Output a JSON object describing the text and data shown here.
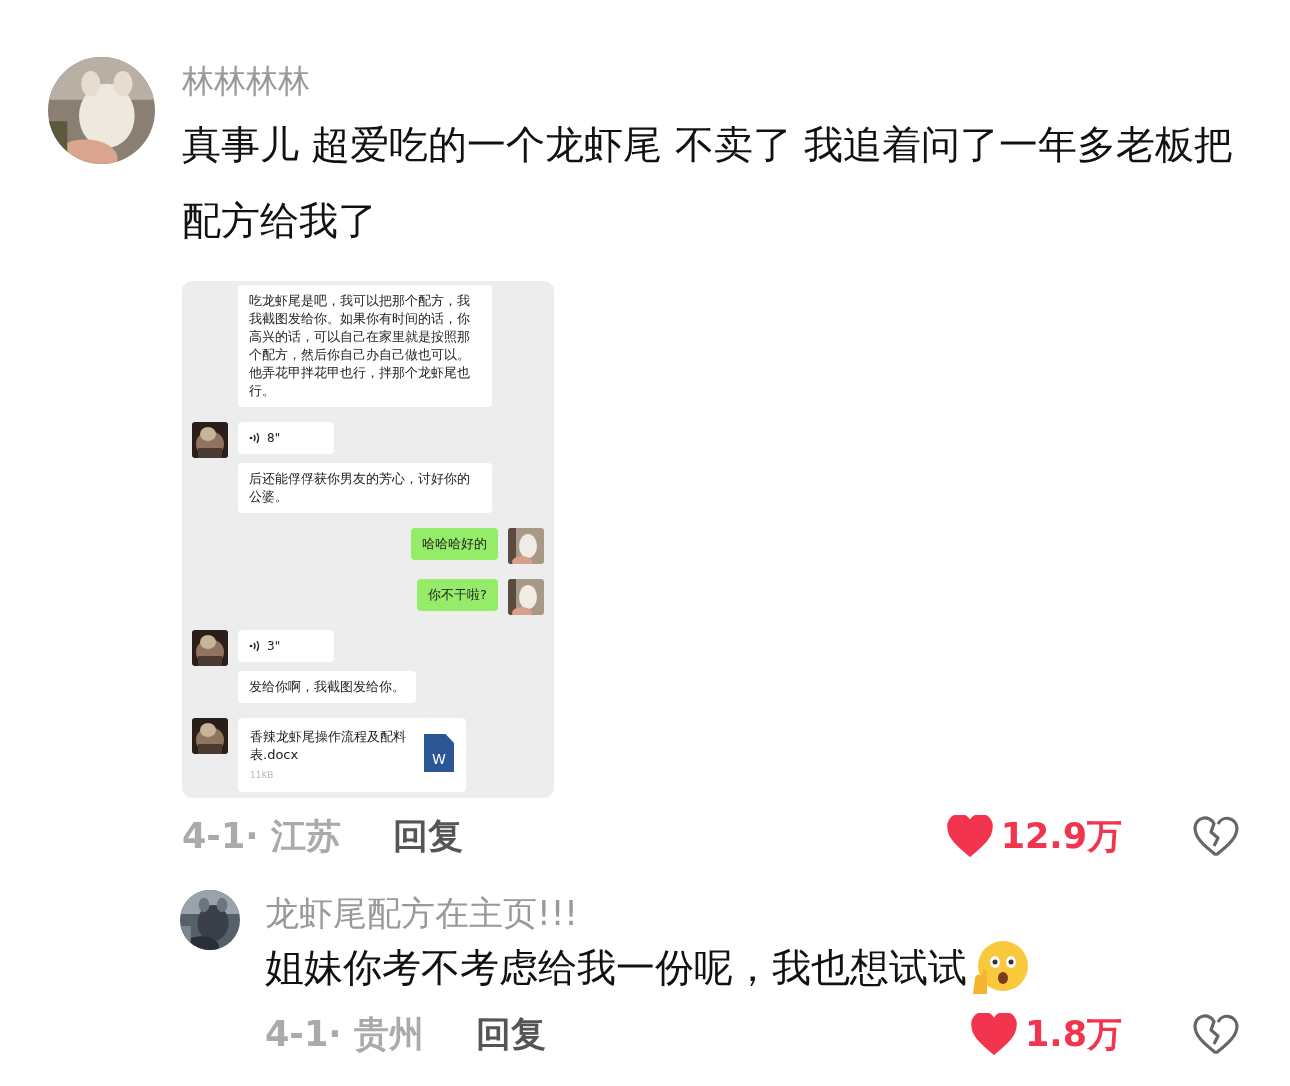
{
  "comment": {
    "username": "林林林林",
    "text": "真事儿 超爱吃的一个龙虾尾 不卖了 我追着问了一年多老板把配方给我了",
    "chat_screenshot": {
      "messages": [
        {
          "kind": "text_in",
          "avatar": false,
          "text": "吃龙虾尾是吧，我可以把那个配方，我我截图发给你。如果你有时间的话，你高兴的话，可以自己在家里就是按照那个配方，然后你自己办自己做也可以。他弄花甲拌花甲也行，拌那个龙虾尾也行。"
        },
        {
          "kind": "voice",
          "avatar": true,
          "text": "8\""
        },
        {
          "kind": "text_in",
          "avatar": false,
          "text": "后还能俘俘获你男友的芳心，讨好你的公婆。"
        },
        {
          "kind": "text_out",
          "avatar": true,
          "text": "哈哈哈好的"
        },
        {
          "kind": "text_out",
          "avatar": true,
          "text": "你不干啦?"
        },
        {
          "kind": "voice",
          "avatar": true,
          "text": "3\""
        },
        {
          "kind": "text_in",
          "avatar": false,
          "text": "发给你啊，我截图发给你。"
        },
        {
          "kind": "file",
          "avatar": true,
          "name": "香辣龙虾尾操作流程及配料表.docx",
          "size": "11KB",
          "file_icon_letter": "W"
        }
      ]
    },
    "meta": "4-1· 江苏",
    "reply_button": "回复",
    "likes": {
      "liked": true,
      "count": "12.9万"
    }
  },
  "reply": {
    "username": "龙虾尾配方在主页!!!",
    "text": "姐妹你考不考虑给我一份呢，我也想试试",
    "emoji": true,
    "meta": "4-1· 贵州",
    "reply_button": "回复",
    "likes": {
      "liked": true,
      "count": "1.8万"
    }
  }
}
